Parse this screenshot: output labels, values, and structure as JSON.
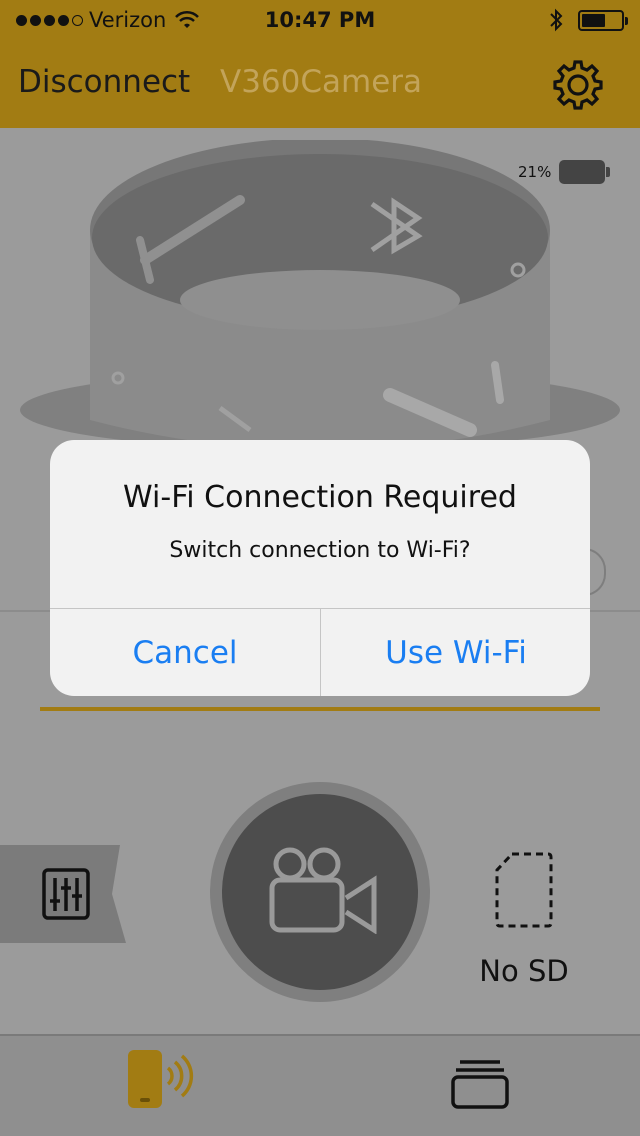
{
  "status_bar": {
    "carrier": "Verizon",
    "time": "10:47 PM",
    "signal_bars": 4,
    "signal_max": 5
  },
  "nav": {
    "disconnect_label": "Disconnect",
    "title": "V360Camera",
    "settings_icon": "gear-icon"
  },
  "camera": {
    "battery_text": "21%"
  },
  "controls": {
    "sd_label": "No SD"
  },
  "alert": {
    "title": "Wi-Fi Connection Required",
    "message": "Switch connection to Wi-Fi?",
    "cancel_label": "Cancel",
    "confirm_label": "Use Wi-Fi"
  },
  "colors": {
    "brand_gold": "#a27c13",
    "title_gold": "#c3a45a",
    "alert_button": "#1a7ef2",
    "dim_background": "#9b9b9b"
  },
  "tabs": [
    {
      "icon": "camera-connect-icon",
      "active": true
    },
    {
      "icon": "gallery-icon",
      "active": false
    }
  ]
}
